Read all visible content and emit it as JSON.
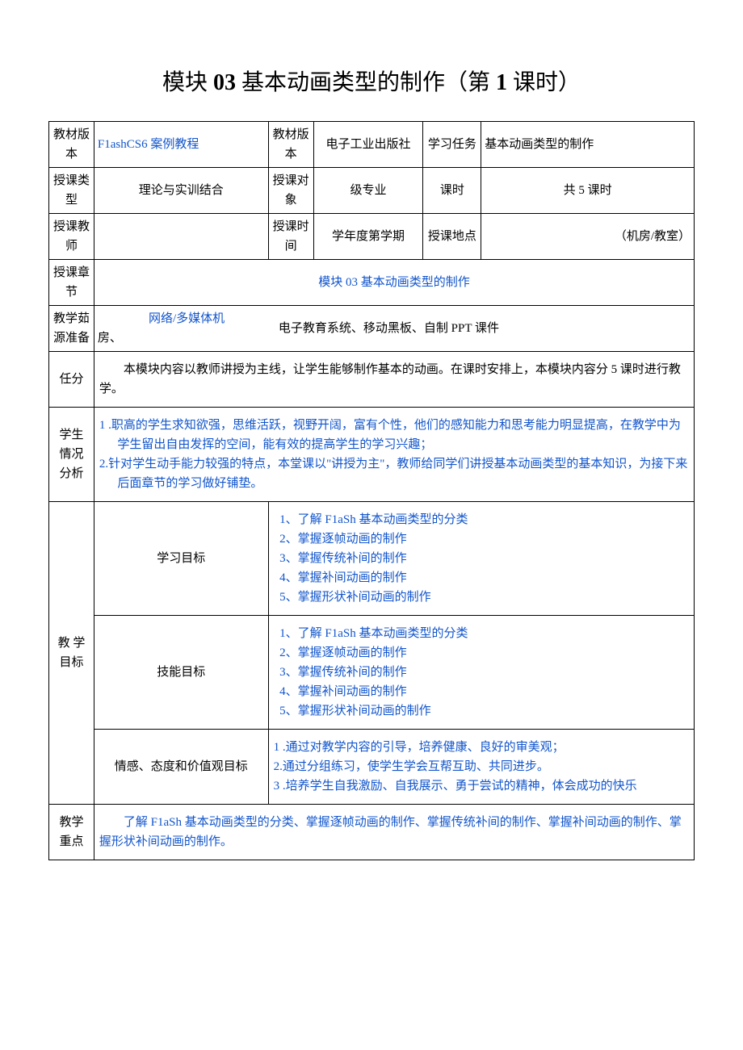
{
  "title": {
    "prefix": "模块 ",
    "num": "03",
    "mid": " 基本动画类型的制作（第 ",
    "lesson": "1",
    "suffix": " 课时）"
  },
  "row1": {
    "c1": "教材版本",
    "c2": "F1ashCS6 案例教程",
    "c3": "教材版本",
    "c4": "电子工业出版社",
    "c5": "学习任务",
    "c6": "基本动画类型的制作"
  },
  "row2": {
    "c1": "授课类型",
    "c2": "理论与实训结合",
    "c3": "授课对象",
    "c4": "级专业",
    "c5": "课时",
    "c6": "共 5 课时"
  },
  "row3": {
    "c1": "授课教师",
    "c2": "",
    "c3": "授课时间",
    "c4": "学年度第学期",
    "c5": "授课地点",
    "c6": "（机房/教室）"
  },
  "row4": {
    "c1": "授课章节",
    "c2": "模块 03 基本动画类型的制作"
  },
  "row5": {
    "c1": "教学茹源准备",
    "c2a": "网络/多媒体机",
    "c2b": "房、",
    "c2c": "电子教育系统、移动黑板、自制 PPT 课件"
  },
  "row6": {
    "c1": "任分",
    "c2": "本模块内容以教师讲授为主线，让学生能够制作基本的动画。在课时安排上，本模块内容分 5 课时进行教学。"
  },
  "row7": {
    "c1": "学生情况分析",
    "l1": "1   .职高的学生求知欲强，思维活跃，视野开阔，富有个性，他们的感知能力和思考能力明显提高，在教学中为学生留出自由发挥的空间，能有效的提高学生的学习兴趣；",
    "l2": "2.针对学生动手能力较强的特点，本堂课以\"讲授为主\"，教师给同学们讲授基本动画类型的基本知识，为接下来后面章节的学习做好铺垫。"
  },
  "goals": {
    "header": "教  学目标",
    "study": {
      "label": "学习目标",
      "items": [
        "1、了解 F1aSh 基本动画类型的分类",
        "2、掌握逐帧动画的制作",
        "3、掌握传统补间的制作",
        "4、掌握补间动画的制作",
        "5、掌握形状补间动画的制作"
      ]
    },
    "skill": {
      "label": "技能目标",
      "items": [
        "1、了解 F1aSh 基本动画类型的分类",
        "2、掌握逐帧动画的制作",
        "3、掌握传统补间的制作",
        "4、掌握补间动画的制作",
        "5、掌握形状补间动画的制作"
      ]
    },
    "emotion": {
      "label": "情感、态度和价值观目标",
      "l1": "1        .通过对教学内容的引导，培养健康、良好的审美观；",
      "l2": "2.通过分组练习，使学生学会互帮互助、共同进步。",
      "l3": "3        .培养学生自我激励、自我展示、勇于尝试的精神，体会成功的快乐"
    }
  },
  "keypoint": {
    "c1": "教学重点",
    "c2": "了解 F1aSh 基本动画类型的分类、掌握逐帧动画的制作、掌握传统补间的制作、掌握补间动画的制作、掌握形状补间动画的制作。"
  }
}
